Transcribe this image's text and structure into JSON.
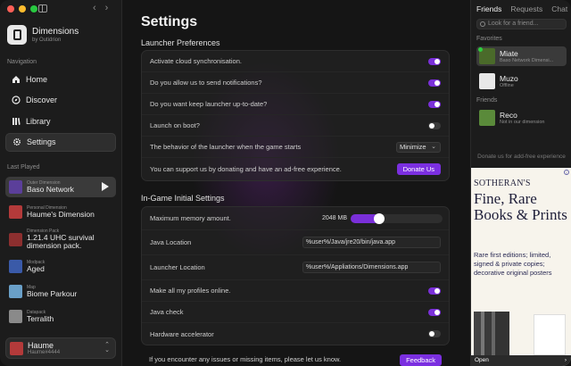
{
  "app": {
    "name": "Dimensions",
    "subtitle": "by Outidrion"
  },
  "sidebar": {
    "nav_label": "Navigation",
    "nav": [
      {
        "label": "Home",
        "icon": "home-icon"
      },
      {
        "label": "Discover",
        "icon": "compass-icon"
      },
      {
        "label": "Library",
        "icon": "library-icon"
      },
      {
        "label": "Settings",
        "icon": "gear-icon"
      }
    ],
    "played_label": "Last Played",
    "played": [
      {
        "type": "Outer Dimension",
        "name": "Baso Network",
        "color": "#5b3f9a"
      },
      {
        "type": "Personal Dimension",
        "name": "Haume's Dimension",
        "color": "#b33a3a"
      },
      {
        "type": "Dimension Pack",
        "name": "1.21.4 UHC survival dimension pack.",
        "color": "#8c2f2f"
      },
      {
        "type": "Modpack",
        "name": "Aged",
        "color": "#3a5aa8"
      },
      {
        "type": "Map",
        "name": "Biome Parkour",
        "color": "#6aa0c8"
      },
      {
        "type": "Datapack",
        "name": "Terralith",
        "color": "#8a8a8a"
      }
    ],
    "account": {
      "name": "Haume",
      "tag": "Haume#4444",
      "color": "#b33a3a"
    }
  },
  "main": {
    "title": "Settings",
    "launcher_section": "Launcher Preferences",
    "launcher_rows": [
      {
        "label": "Activate cloud synchronisation.",
        "kind": "toggle",
        "on": true
      },
      {
        "label": "Do you allow us to send notifications?",
        "kind": "toggle",
        "on": true
      },
      {
        "label": "Do you want keep launcher up-to-date?",
        "kind": "toggle",
        "on": true
      },
      {
        "label": "Launch on boot?",
        "kind": "toggle",
        "on": false
      },
      {
        "label": "The behavior of the launcher when the game starts",
        "kind": "select",
        "value": "Minimize"
      },
      {
        "label": "You can support us by donating and have an ad-free experience.",
        "kind": "button",
        "value": "Donate Us"
      }
    ],
    "ingame_section": "In-Game Initial Settings",
    "memory": {
      "label": "Maximum memory amount.",
      "value": "2048 MB",
      "fraction": 0.25
    },
    "java_location": {
      "label": "Java Location",
      "value": "%user%/Java/jre20/bin/java.app"
    },
    "launcher_location": {
      "label": "Launcher Location",
      "value": "%user%/Appliations/Dimensions.app"
    },
    "ingame_toggles": [
      {
        "label": "Make all my profiles online.",
        "on": true
      },
      {
        "label": "Java check",
        "on": true
      },
      {
        "label": "Hardware accelerator",
        "on": false
      }
    ],
    "footer": {
      "text": "If you encounter any issues or missing items, please let us know.",
      "button": "Feedback"
    }
  },
  "friends": {
    "tabs": [
      "Friends",
      "Requests",
      "Chat"
    ],
    "search_placeholder": "Look for a friend...",
    "favorites_label": "Favorites",
    "favorites": [
      {
        "name": "Miate",
        "status": "Baso Network Dimensi...",
        "online": true,
        "color": "#4a6a2a"
      },
      {
        "name": "Muzo",
        "status": "Offline",
        "online": false,
        "color": "#e8e8e8"
      }
    ],
    "friends_label": "Friends",
    "friends": [
      {
        "name": "Reco",
        "status": "Not in our dimension",
        "online": false,
        "color": "#5a8a3a"
      }
    ],
    "donate_note": "Donate us for add-free experience"
  },
  "ad": {
    "brand": "SOTHERAN'S",
    "headline": "Fine, Rare Books & Prints",
    "body": "Rare first editions; limited, signed & private copies; decorative original posters",
    "open_label": "Open"
  }
}
